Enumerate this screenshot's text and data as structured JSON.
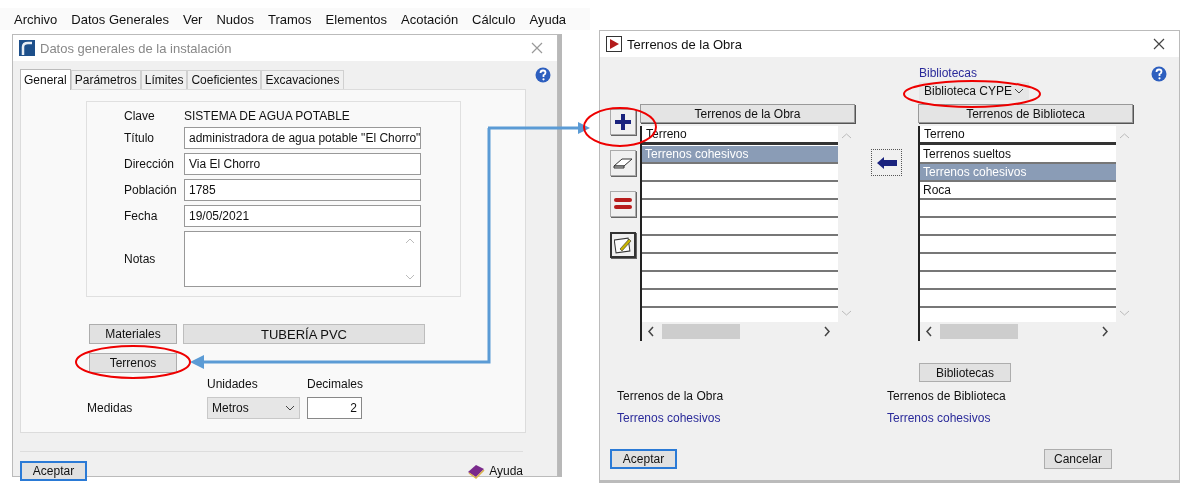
{
  "menu_bar": [
    {
      "label": "Archivo"
    },
    {
      "label": "Datos Generales"
    },
    {
      "label": "Ver"
    },
    {
      "label": "Nudos"
    },
    {
      "label": "Tramos"
    },
    {
      "label": "Elementos"
    },
    {
      "label": "Acotación"
    },
    {
      "label": "Cálculo"
    },
    {
      "label": "Ayuda"
    }
  ],
  "general_dialog": {
    "title": "Datos generales de la instalación",
    "tabs": [
      {
        "label": "General",
        "selected": true
      },
      {
        "label": "Parámetros",
        "selected": false
      },
      {
        "label": "Límites",
        "selected": false
      },
      {
        "label": "Coeficientes",
        "selected": false
      },
      {
        "label": "Excavaciones",
        "selected": false
      }
    ],
    "fields": [
      {
        "kind": "text",
        "label": "Clave",
        "value": "SISTEMA DE AGUA POTABLE"
      },
      {
        "kind": "input",
        "label": "Título",
        "value": "administradora de agua potable \"El Chorro\""
      },
      {
        "kind": "input",
        "label": "Dirección",
        "value": "Via El Chorro"
      },
      {
        "kind": "input",
        "label": "Población",
        "value": "1785"
      },
      {
        "kind": "input",
        "label": "Fecha",
        "value": "19/05/2021"
      },
      {
        "kind": "textarea",
        "label": "Notas"
      }
    ],
    "materials_button": "Materiales",
    "material_value": "TUBERÍA PVC",
    "terrain_button": "Terrenos",
    "units_label": "Unidades",
    "decimals_label": "Decimales",
    "measures_label": "Medidas",
    "units_value": "Metros",
    "decimals_value": "2",
    "accept_button": "Aceptar",
    "help_button": "Ayuda"
  },
  "terrain_dialog": {
    "title": "Terrenos de la Obra",
    "libraries_label": "Bibliotecas",
    "library_select": "Biblioteca CYPE",
    "project_list": {
      "header": "Terrenos de la Obra",
      "column": "Terreno",
      "rows": [
        {
          "label": "Terrenos cohesivos",
          "selected": true
        }
      ]
    },
    "library_list": {
      "header": "Terrenos de Biblioteca",
      "column": "Terreno",
      "rows": [
        {
          "label": "Terrenos sueltos",
          "selected": false
        },
        {
          "label": "Terrenos cohesivos",
          "selected": true
        },
        {
          "label": "Roca",
          "selected": false
        }
      ]
    },
    "libraries_button": "Bibliotecas",
    "summary": [
      {
        "title": "Terrenos de la Obra",
        "value": "Terrenos cohesivos"
      },
      {
        "title": "Terrenos de Biblioteca",
        "value": "Terrenos cohesivos"
      }
    ],
    "accept_button": "Aceptar",
    "cancel_button": "Cancelar"
  }
}
